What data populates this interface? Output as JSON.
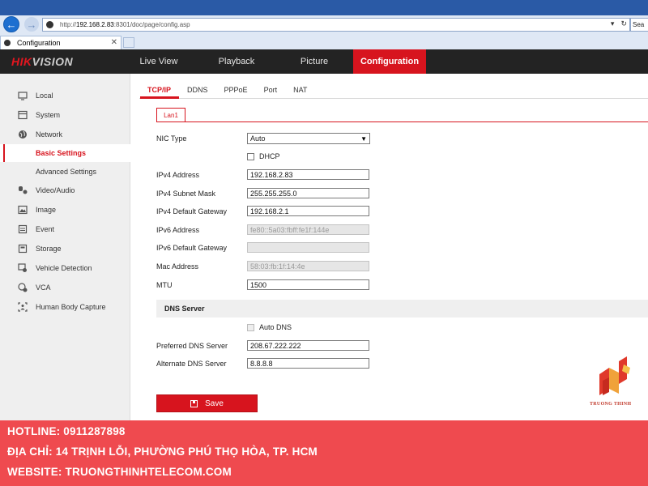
{
  "browser": {
    "url_prefix": "http://",
    "url_host": "192.168.2.83",
    "url_rest": ":8301/doc/page/config.asp",
    "search_stub": "Sea",
    "tab_title": "Configuration"
  },
  "brand": {
    "logo_red": "HIK",
    "logo_rest": "VISION"
  },
  "main_nav": {
    "live_view": "Live View",
    "playback": "Playback",
    "picture": "Picture",
    "configuration": "Configuration"
  },
  "sidebar": {
    "items": [
      {
        "label": "Local",
        "icon": "monitor-icon"
      },
      {
        "label": "System",
        "icon": "system-icon"
      },
      {
        "label": "Network",
        "icon": "globe-icon"
      },
      {
        "label": "Basic Settings",
        "icon": ""
      },
      {
        "label": "Advanced Settings",
        "icon": ""
      },
      {
        "label": "Video/Audio",
        "icon": "mic-icon"
      },
      {
        "label": "Image",
        "icon": "image-icon"
      },
      {
        "label": "Event",
        "icon": "calendar-icon"
      },
      {
        "label": "Storage",
        "icon": "storage-icon"
      },
      {
        "label": "Vehicle Detection",
        "icon": "car-icon"
      },
      {
        "label": "VCA",
        "icon": "vca-icon"
      },
      {
        "label": "Human Body Capture",
        "icon": "person-icon"
      }
    ]
  },
  "sub_tabs": [
    "TCP/IP",
    "DDNS",
    "PPPoE",
    "Port",
    "NAT"
  ],
  "lan_tab": "Lan1",
  "form": {
    "nic_type_label": "NIC Type",
    "nic_type_value": "Auto",
    "dhcp_label": "DHCP",
    "ipv4_address_label": "IPv4 Address",
    "ipv4_address_value": "192.168.2.83",
    "ipv4_subnet_label": "IPv4 Subnet Mask",
    "ipv4_subnet_value": "255.255.255.0",
    "ipv4_gateway_label": "IPv4 Default Gateway",
    "ipv4_gateway_value": "192.168.2.1",
    "ipv6_address_label": "IPv6 Address",
    "ipv6_address_value": "fe80::5a03:fbff:fe1f:144e",
    "ipv6_gateway_label": "IPv6 Default Gateway",
    "ipv6_gateway_value": "",
    "mac_label": "Mac Address",
    "mac_value": "58:03:fb:1f:14:4e",
    "mtu_label": "MTU",
    "mtu_value": "1500",
    "dns_section": "DNS Server",
    "auto_dns_label": "Auto DNS",
    "preferred_dns_label": "Preferred DNS Server",
    "preferred_dns_value": "208.67.222.222",
    "alternate_dns_label": "Alternate DNS Server",
    "alternate_dns_value": "8.8.8.8",
    "save_label": "Save"
  },
  "watermark": {
    "text": "TRUONG THINH"
  },
  "banner": {
    "hotline": "HOTLINE: 0911287898",
    "address": "ĐỊA CHỈ: 14 TRỊNH LỖI, PHƯỜNG PHÚ THỌ HÒA, TP. HCM",
    "website": "WEBSITE: TRUONGTHINHTELECOM.COM"
  },
  "colors": {
    "accent": "#d7141e",
    "header_bg": "#232323",
    "banner_bg": "#ef4a4f"
  }
}
